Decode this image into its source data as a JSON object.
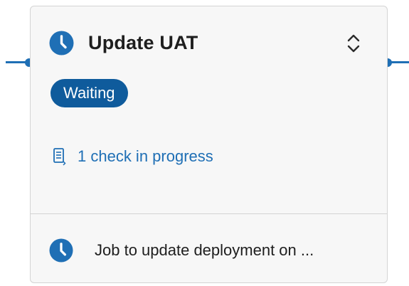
{
  "stage": {
    "title": "Update UAT",
    "status_badge": "Waiting",
    "checks_text": "1 check in progress",
    "job_text": "Job to update deployment on ..."
  },
  "colors": {
    "accent": "#1f6fb5",
    "badge_bg": "#0f5b9c",
    "card_bg": "#f7f7f7",
    "border": "#d4d4d4",
    "text": "#1e1e1e"
  },
  "icons": {
    "stage_status": "clock-icon",
    "expand": "chevron-up-down-icon",
    "checks": "checklist-icon",
    "job_status": "clock-icon"
  }
}
